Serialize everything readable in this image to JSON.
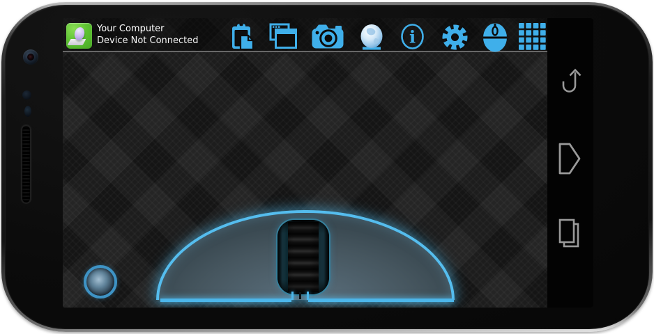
{
  "appbar": {
    "title": "Your Computer",
    "status": "Device Not Connected",
    "app_icon": "remote-mouse-app-logo",
    "toolbar_icons": [
      "clipboard-paste",
      "windows",
      "camera",
      "webcam",
      "info",
      "settings-gear",
      "mouse",
      "keyboard-grid"
    ]
  },
  "navbar": {
    "icons": [
      "back",
      "home",
      "recent-apps"
    ]
  },
  "trackpad": {
    "components": [
      "mouse-left-click-area",
      "mouse-right-click-area",
      "scroll-wheel",
      "pointer-button"
    ]
  },
  "colors": {
    "icon_blue": "#3FAFEA",
    "glow_blue": "#55BDEE",
    "app_green": "#5FC433",
    "nav_gray": "#9A9A9A",
    "bar_divider": "#686868",
    "mouse_body_slate": "#46565F"
  }
}
